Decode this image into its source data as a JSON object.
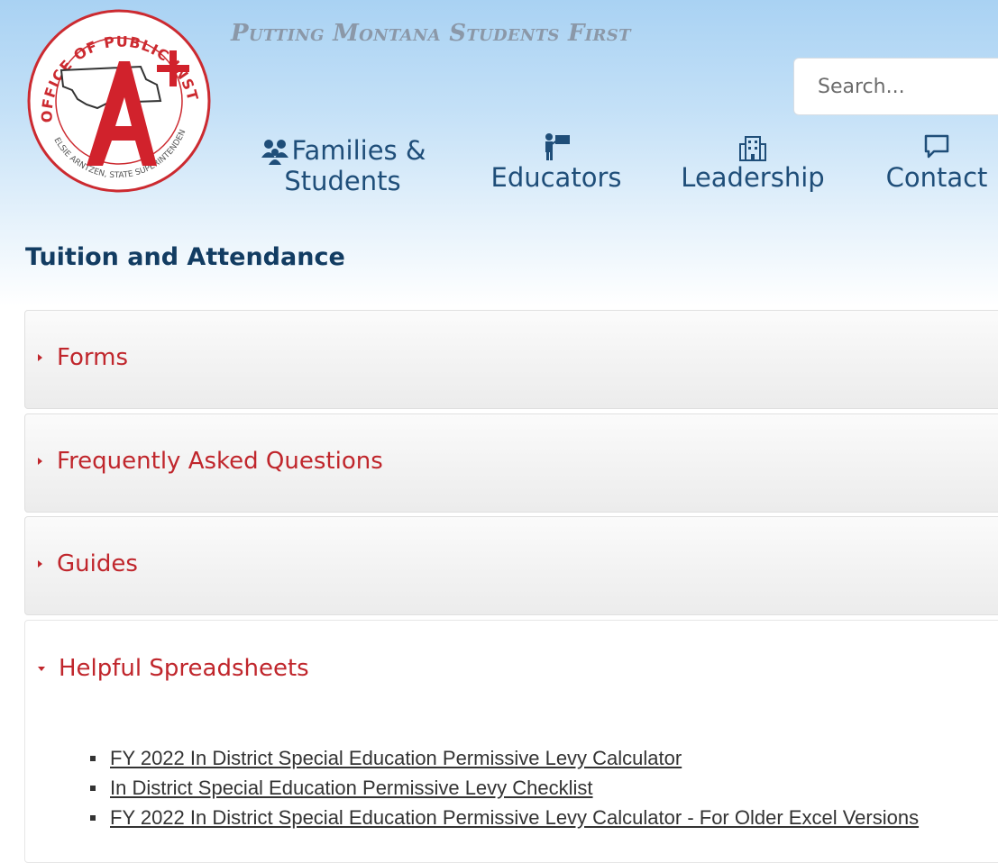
{
  "header": {
    "logo": {
      "ring_text": "OFFICE OF PUBLIC INSTRUCTION",
      "sub_ring_text": "ELSIE ARNTZEN, STATE SUPERINTENDENT",
      "icon": "a-plus-montana-seal",
      "accent_color": "#d1222c"
    },
    "tagline": "Putting Montana Students First",
    "search": {
      "placeholder": "Search..."
    },
    "nav": [
      {
        "label_line1": "Families &",
        "label_line2": "Students",
        "icon": "family-icon"
      },
      {
        "label": "Educators",
        "icon": "teacher-icon"
      },
      {
        "label": "Leadership",
        "icon": "building-icon"
      },
      {
        "label": "Contact",
        "icon": "chat-icon"
      }
    ]
  },
  "page": {
    "title": "Tuition and Attendance",
    "accordion": [
      {
        "title": "Forms",
        "expanded": false
      },
      {
        "title": "Frequently Asked Questions",
        "expanded": false
      },
      {
        "title": "Guides",
        "expanded": false
      },
      {
        "title": "Helpful Spreadsheets",
        "expanded": true,
        "links": [
          "FY 2022 In District Special Education Permissive Levy Calculator",
          "In District Special Education Permissive Levy Checklist",
          "FY 2022 In District Special Education Permissive Levy Calculator - For Older Excel Versions"
        ]
      }
    ]
  },
  "colors": {
    "nav_text": "#1f4e79",
    "title_text": "#123c62",
    "accordion_text": "#c0262c",
    "tagline": "#8b98a8"
  }
}
